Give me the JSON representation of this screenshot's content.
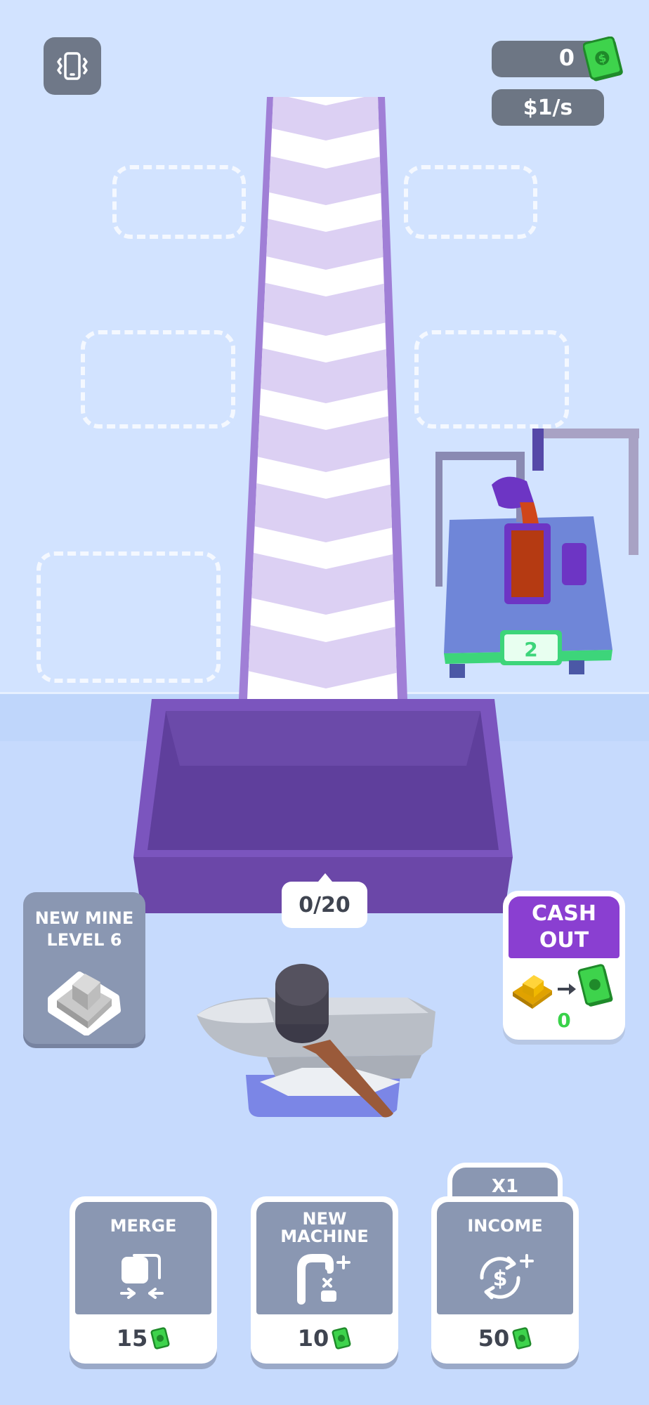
{
  "hud": {
    "money": "0",
    "rate": "$1/s"
  },
  "bin": {
    "counter": "0/20"
  },
  "machine": {
    "level": "2"
  },
  "new_mine": {
    "line1": "NEW MINE",
    "line2": "LEVEL 6"
  },
  "cash_out": {
    "line1": "CASH",
    "line2": "OUT",
    "value": "0"
  },
  "cards": {
    "merge": {
      "label": "MERGE",
      "price": "15"
    },
    "new_machine": {
      "label_line1": "NEW",
      "label_line2": "MACHINE",
      "price": "10"
    },
    "income": {
      "label": "INCOME",
      "price": "50",
      "multiplier": "X1"
    }
  },
  "colors": {
    "background": "#c9dcff",
    "conveyor_border": "#a07fd6",
    "conveyor_stripe": "#dcd0f3",
    "bin": "#6b47a8",
    "cash_out_header": "#8a3fd1",
    "card_grey": "#8a97b2",
    "cash_green": "#39d24a"
  }
}
